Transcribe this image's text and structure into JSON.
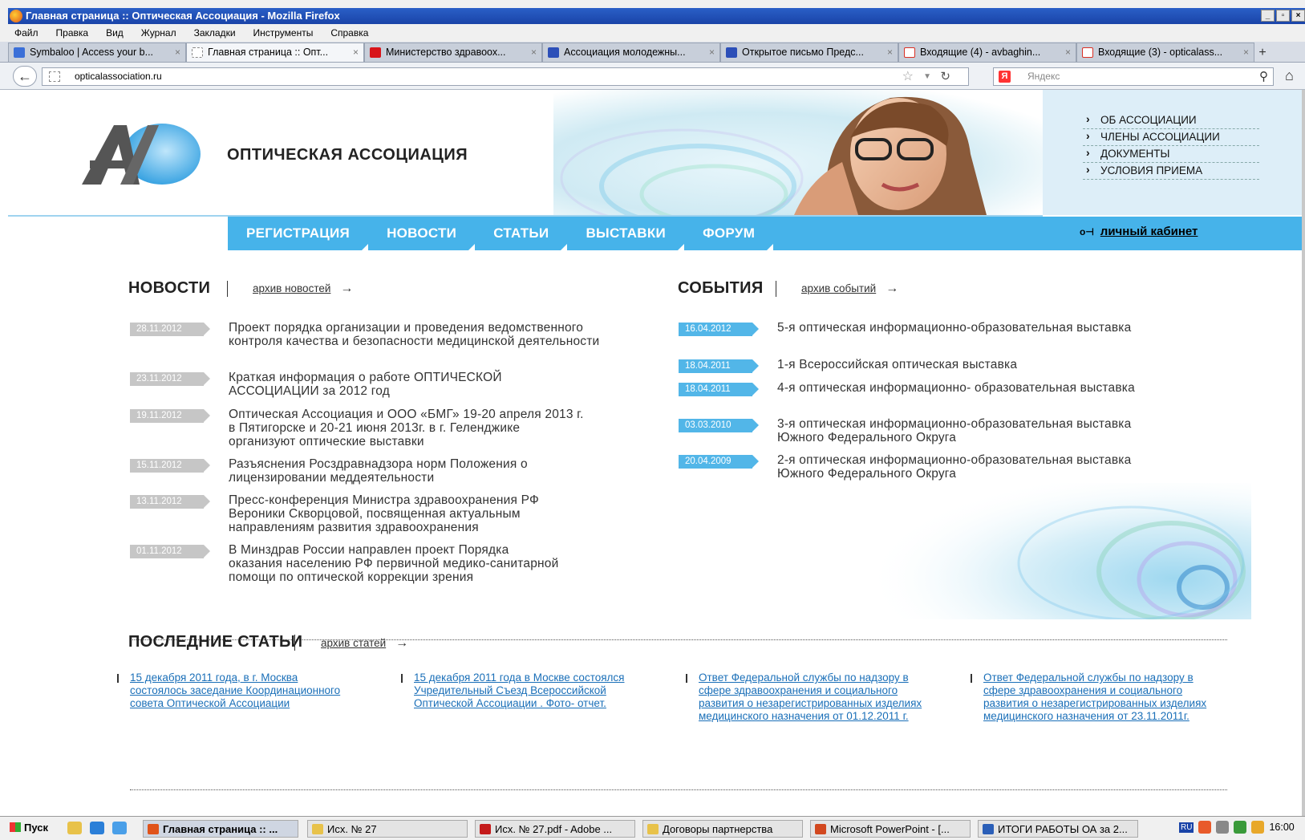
{
  "window": {
    "title": "Главная страница :: Оптическая Ассоциация - Mozilla Firefox"
  },
  "menu": [
    "Файл",
    "Правка",
    "Вид",
    "Журнал",
    "Закладки",
    "Инструменты",
    "Справка"
  ],
  "tabs": [
    {
      "label": "Symbaloo | Access your b...",
      "icon_color": "#3a6fd8"
    },
    {
      "label": "Главная страница :: Опт...",
      "icon_color": "#ffffff",
      "active": true
    },
    {
      "label": "Министерство здравоох...",
      "icon_color": "#d8141a"
    },
    {
      "label": "Ассоциация молодежны...",
      "icon_color": "#2c4fb8"
    },
    {
      "label": "Открытое письмо Предс...",
      "icon_color": "#2c4fb8"
    },
    {
      "label": "Входящие (4) - avbaghin...",
      "icon_color": "#d93025"
    },
    {
      "label": "Входящие (3) - opticalass...",
      "icon_color": "#d93025"
    }
  ],
  "tab_new": "+",
  "nav": {
    "url": "opticalassociation.ru",
    "search_placeholder": "Яндекс",
    "search_engine_glyph": "Я"
  },
  "site": {
    "logo_text": "ОПТИЧЕСКАЯ АССОЦИАЦИЯ",
    "top_menu": [
      "ОБ АССОЦИАЦИИ",
      "ЧЛЕНЫ АССОЦИАЦИИ",
      "ДОКУМЕНТЫ",
      "УСЛОВИЯ ПРИЕМА"
    ],
    "main_nav": [
      "РЕГИСТРАЦИЯ",
      "НОВОСТИ",
      "СТАТЬИ",
      "ВЫСТАВКИ",
      "ФОРУМ"
    ],
    "cabinet_label": "личный кабинет",
    "accent_color": "#46b3ea"
  },
  "news": {
    "title": "НОВОСТИ",
    "archive_link": "архив новостей",
    "items": [
      {
        "date": "28.11.2012",
        "text": "Проект порядка организации и проведения ведомственного контроля качества и безопасности медицинской деятельности"
      },
      {
        "date": "23.11.2012",
        "text": "Краткая информация о работе ОПТИЧЕСКОЙ АССОЦИАЦИИ за 2012 год"
      },
      {
        "date": "19.11.2012",
        "text": "Оптическая Ассоциация и ООО «БМГ» 19-20 апреля 2013 г. в Пятигорске и 20-21 июня 2013г. в г. Геленджике организуют оптические выставки"
      },
      {
        "date": "15.11.2012",
        "text": "Разъяснения Росздравнадзора норм Положения о лицензировании меддеятельности"
      },
      {
        "date": "13.11.2012",
        "text": "Пресс-конференция Министра здравоохранения РФ Вероники Скворцовой, посвященная актуальным направлениям развития здравоохранения"
      },
      {
        "date": "01.11.2012",
        "text": "В Минздрав России направлен проект Порядка оказания населению РФ первичной медико-санитарной помощи по оптической коррекции зрения"
      }
    ]
  },
  "events": {
    "title": "СОБЫТИЯ",
    "archive_link": "архив событий",
    "items": [
      {
        "date": "16.04.2012",
        "text": "5-я оптическая информационно-образовательная выставка"
      },
      {
        "date": "18.04.2011",
        "text": "1-я Всероссийская оптическая выставка"
      },
      {
        "date": "18.04.2011",
        "text": "4-я оптическая информационно- образовательная выставка"
      },
      {
        "date": "03.03.2010",
        "text": "3-я оптическая информационно-образовательная выставка Южного Федерального Округа"
      },
      {
        "date": "20.04.2009",
        "text": "2-я оптическая информационно-образовательная выставка Южного Федерального Округа"
      }
    ]
  },
  "articles": {
    "title": "ПОСЛЕДНИЕ СТАТЬИ",
    "archive_link": "архив статей",
    "items": [
      "15 декабря 2011 года, в г. Москва состоялось заседание Координационного совета Оптической Ассоциации",
      "15 декабря 2011 года в Москве состоялся Учредительный Съезд Всероссийской Оптической Ассоциации . Фото- отчет.",
      "Ответ Федеральной службы по надзору в сфере здравоохранения и социального развития о незарегистрированных изделиях медицинского назначения от 01.12.2011 г.",
      "Ответ Федеральной службы по надзору в сфере здравоохранения и социального развития о незарегистрированных изделиях медицинского назначения от 23.11.2011г."
    ]
  },
  "taskbar": {
    "start": "Пуск",
    "items": [
      {
        "label": "Главная страница :: ...",
        "active": true,
        "icon_color": "#e0531a"
      },
      {
        "label": "Исх. № 27",
        "icon_color": "#e8c24a"
      },
      {
        "label": "Исх. № 27.pdf - Adobe ...",
        "icon_color": "#c41a1a"
      },
      {
        "label": "Договоры партнерства",
        "icon_color": "#e8c24a"
      },
      {
        "label": "Microsoft PowerPoint - [...",
        "icon_color": "#d2481f"
      },
      {
        "label": "ИТОГИ РАБОТЫ ОА за 2...",
        "icon_color": "#2b5fb8"
      }
    ],
    "lang": "RU",
    "clock": "16:00"
  }
}
